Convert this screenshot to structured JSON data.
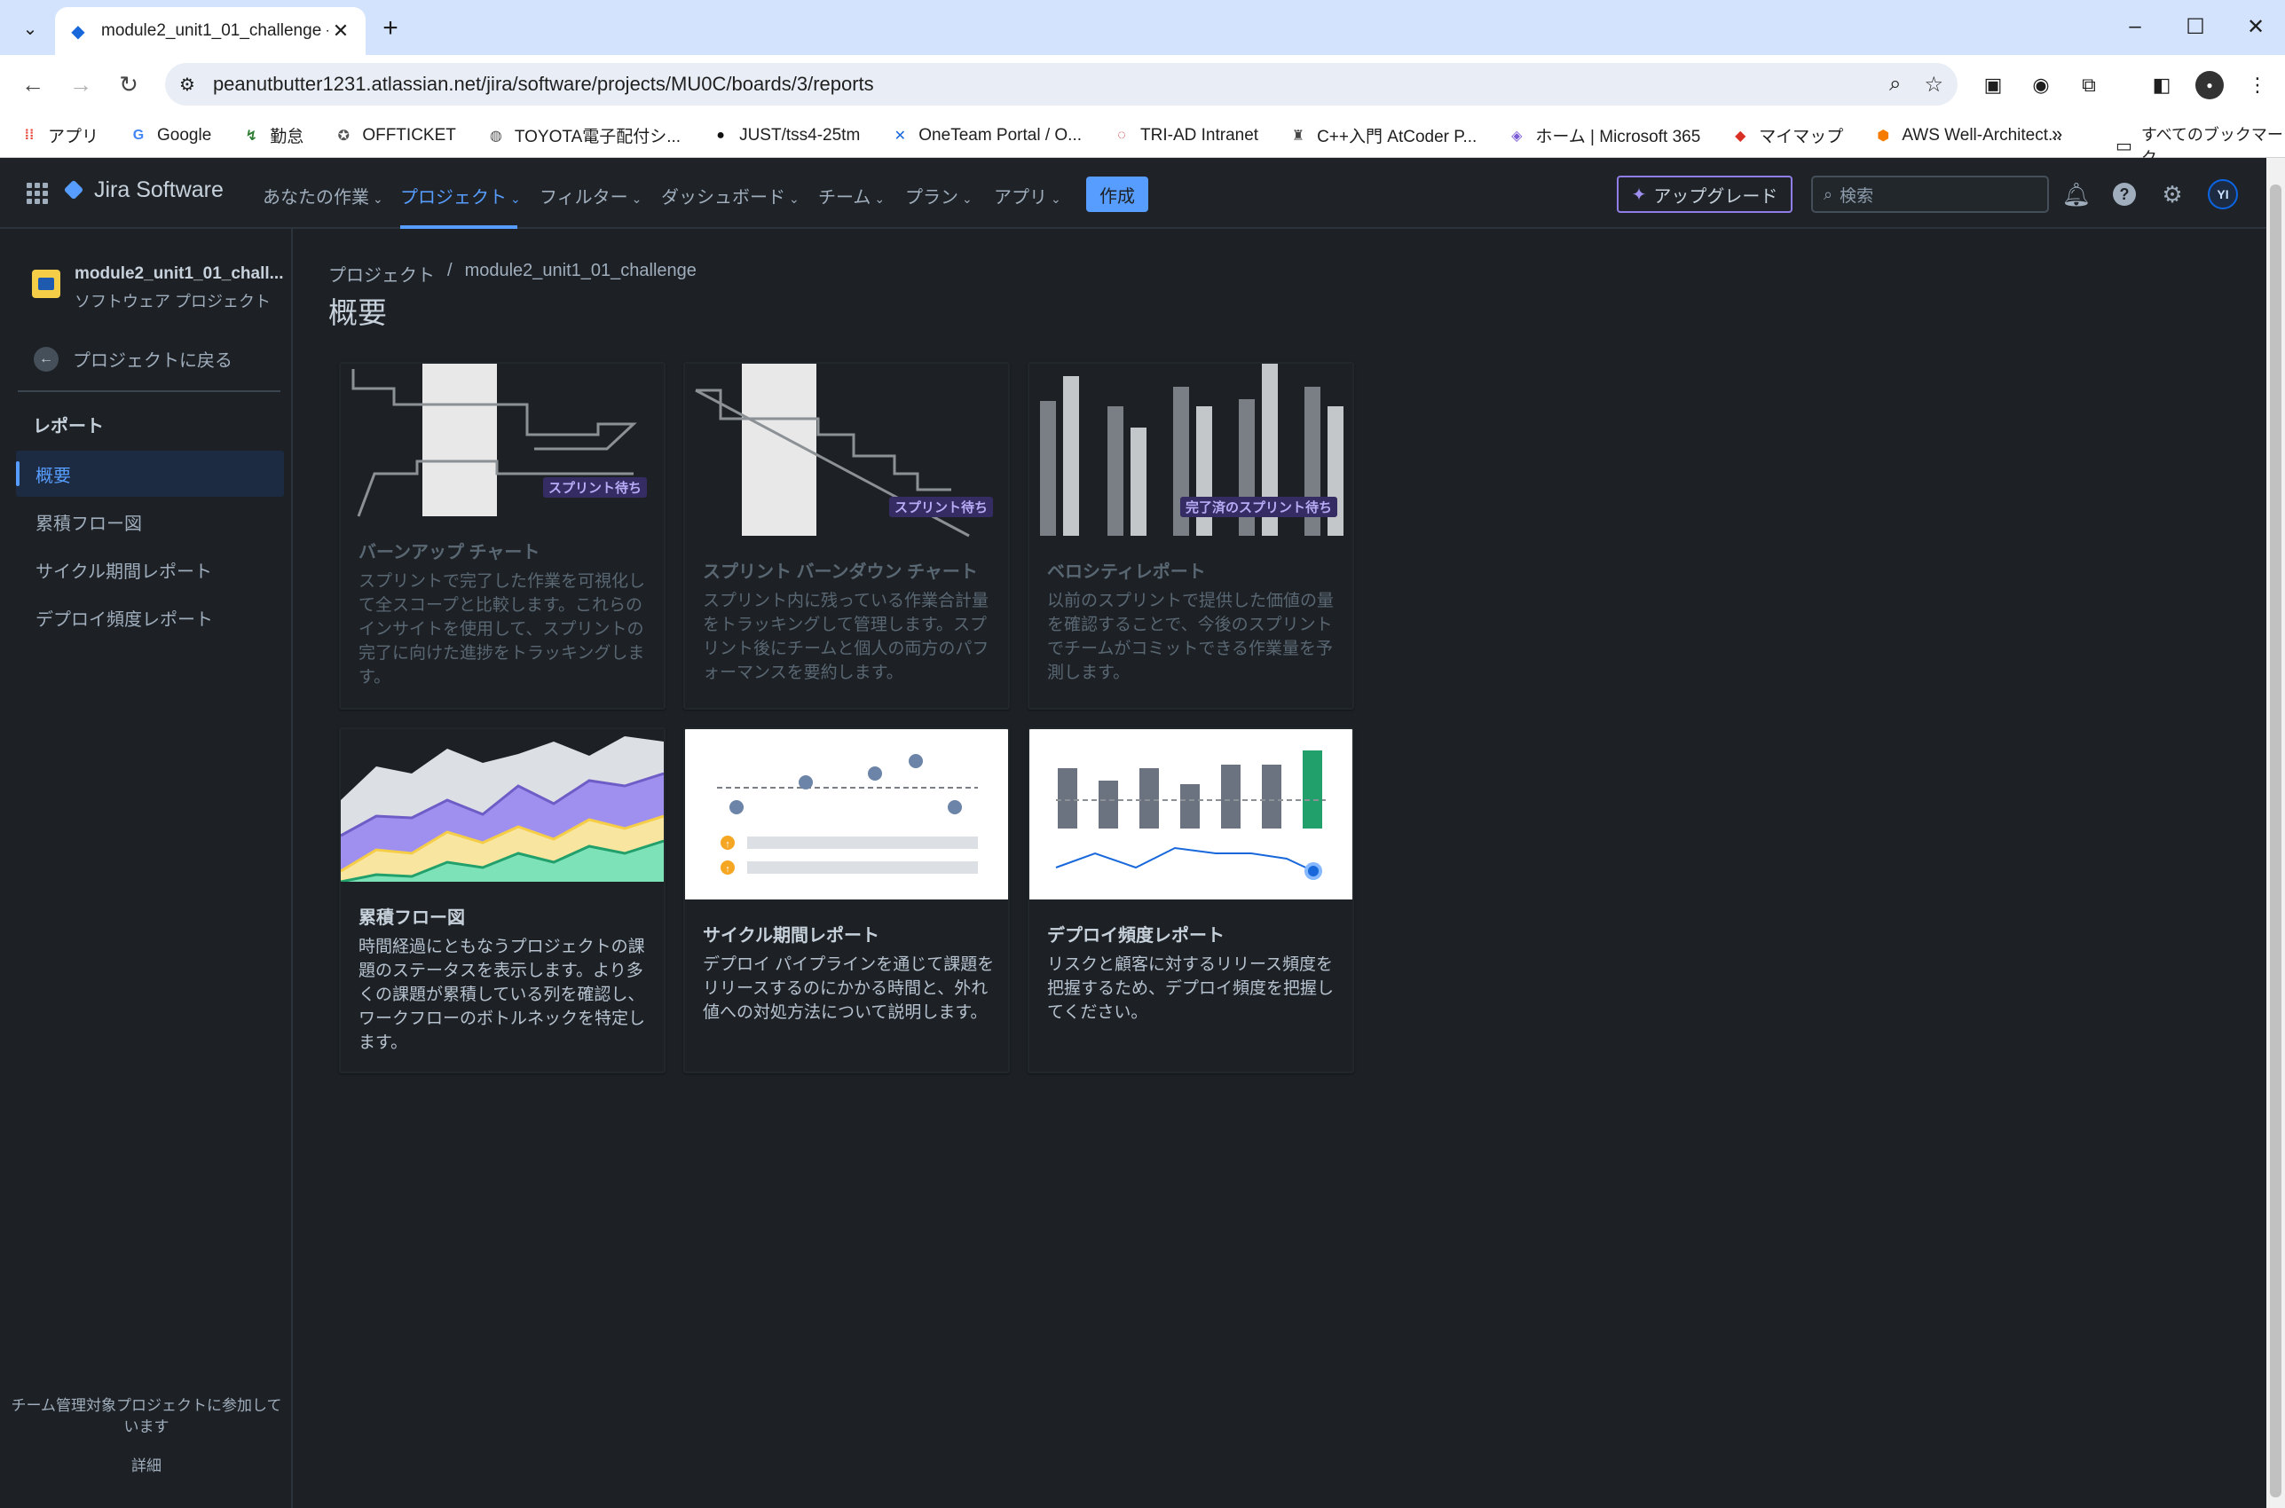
{
  "browser": {
    "tab_title": "module2_unit1_01_challenge -",
    "url": "peanutbutter1231.atlassian.net/jira/software/projects/MU0C/boards/3/reports",
    "bookmarks": [
      {
        "label": "アプリ",
        "icon": "apps-grid-icon"
      },
      {
        "label": "Google",
        "icon": "google-icon"
      },
      {
        "label": "勤怠",
        "icon": "kintai-icon"
      },
      {
        "label": "OFFTICKET",
        "icon": "offticket-icon"
      },
      {
        "label": "TOYOTA電子配付シ...",
        "icon": "globe-icon"
      },
      {
        "label": "JUST/tss4-25tm",
        "icon": "github-icon"
      },
      {
        "label": "OneTeam Portal / O...",
        "icon": "confluence-icon"
      },
      {
        "label": "TRI-AD Intranet",
        "icon": "toyota-icon"
      },
      {
        "label": "C++入門 AtCoder P...",
        "icon": "atcoder-icon"
      },
      {
        "label": "ホーム | Microsoft 365",
        "icon": "m365-icon"
      },
      {
        "label": "マイマップ",
        "icon": "maps-icon"
      },
      {
        "label": "AWS Well-Architect...",
        "icon": "aws-icon"
      }
    ],
    "all_bookmarks": "すべてのブックマーク"
  },
  "jira": {
    "product": "Jira Software",
    "menu": [
      {
        "label": "あなたの作業"
      },
      {
        "label": "プロジェクト"
      },
      {
        "label": "フィルター"
      },
      {
        "label": "ダッシュボード"
      },
      {
        "label": "チーム"
      },
      {
        "label": "プラン"
      },
      {
        "label": "アプリ"
      }
    ],
    "create": "作成",
    "upgrade": "アップグレード",
    "search_placeholder": "検索",
    "avatar_initials": "YI",
    "accent": "#579dff"
  },
  "sidebar": {
    "project_name": "module2_unit1_01_chall...",
    "project_type": "ソフトウェア プロジェクト",
    "back": "プロジェクトに戻る",
    "section": "レポート",
    "items": [
      {
        "label": "概要",
        "active": true
      },
      {
        "label": "累積フロー図"
      },
      {
        "label": "サイクル期間レポート"
      },
      {
        "label": "デプロイ頻度レポート"
      }
    ],
    "footer_text": "チーム管理対象プロジェクトに参加しています",
    "footer_link": "詳細"
  },
  "main": {
    "breadcrumb": [
      "プロジェクト",
      "module2_unit1_01_challenge"
    ],
    "title": "概要",
    "cards": [
      {
        "title": "バーンアップ チャート",
        "badge": "スプリント待ち",
        "desc": "スプリントで完了した作業を可視化して全スコープと比較します。これらのインサイトを使用して、スプリントの完了に向けた進捗をトラッキングします。"
      },
      {
        "title": "スプリント バーンダウン チャート",
        "badge": "スプリント待ち",
        "desc": "スプリント内に残っている作業合計量をトラッキングして管理します。スプリント後にチームと個人の両方のパフォーマンスを要約します。"
      },
      {
        "title": "ベロシティレポート",
        "badge": "完了済のスプリント待ち",
        "desc": "以前のスプリントで提供した価値の量を確認することで、今後のスプリントでチームがコミットできる作業量を予測します。"
      },
      {
        "title": "累積フロー図",
        "desc": "時間経過にともなうプロジェクトの課題のステータスを表示します。より多くの課題が累積している列を確認し、ワークフローのボトルネックを特定します。"
      },
      {
        "title": "サイクル期間レポート",
        "desc": "デプロイ パイプラインを通じて課題をリリースするのにかかる時間と、外れ値への対処方法について説明します。"
      },
      {
        "title": "デプロイ頻度レポート",
        "desc": "リスクと顧客に対するリリース頻度を把握するため、デプロイ頻度を把握してください。"
      }
    ]
  }
}
